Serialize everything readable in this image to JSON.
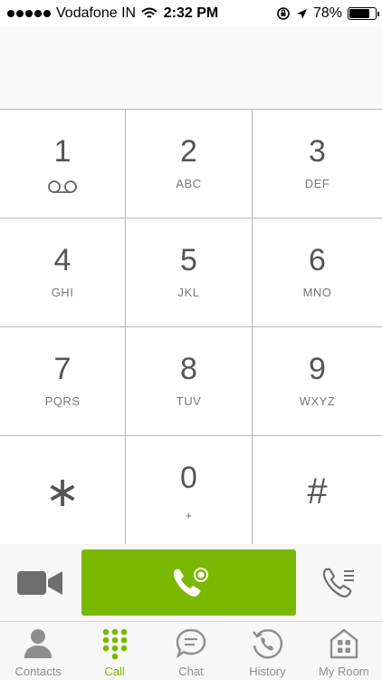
{
  "status_bar": {
    "carrier": "Vodafone IN",
    "time": "2:32 PM",
    "battery": "78%",
    "battery_level": 0.78,
    "icons": [
      "signal-dots-icon",
      "wifi-icon",
      "orientation-lock-icon",
      "location-arrow-icon",
      "battery-icon"
    ]
  },
  "keypad": {
    "keys": [
      {
        "digit": "1",
        "letters": "",
        "icon": "voicemail-icon"
      },
      {
        "digit": "2",
        "letters": "ABC"
      },
      {
        "digit": "3",
        "letters": "DEF"
      },
      {
        "digit": "4",
        "letters": "GHI"
      },
      {
        "digit": "5",
        "letters": "JKL"
      },
      {
        "digit": "6",
        "letters": "MNO"
      },
      {
        "digit": "7",
        "letters": "PQRS"
      },
      {
        "digit": "8",
        "letters": "TUV"
      },
      {
        "digit": "9",
        "letters": "WXYZ"
      },
      {
        "digit": "*",
        "letters": ""
      },
      {
        "digit": "0",
        "letters": "+"
      },
      {
        "digit": "#",
        "letters": ""
      }
    ]
  },
  "call_bar": {
    "video_icon": "video-camera-icon",
    "call_icon": "phone-call-icon",
    "transfer_icon": "phone-list-icon"
  },
  "tabs": [
    {
      "label": "Contacts",
      "icon": "person-icon"
    },
    {
      "label": "Call",
      "icon": "dialpad-icon",
      "active": true
    },
    {
      "label": "Chat",
      "icon": "chat-bubble-icon"
    },
    {
      "label": "History",
      "icon": "history-clock-icon"
    },
    {
      "label": "My Room",
      "icon": "room-icon"
    }
  ],
  "colors": {
    "accent": "#7ab800",
    "inactive": "#8e8e8e",
    "key_text": "#555555",
    "divider": "#b7b7b7"
  }
}
